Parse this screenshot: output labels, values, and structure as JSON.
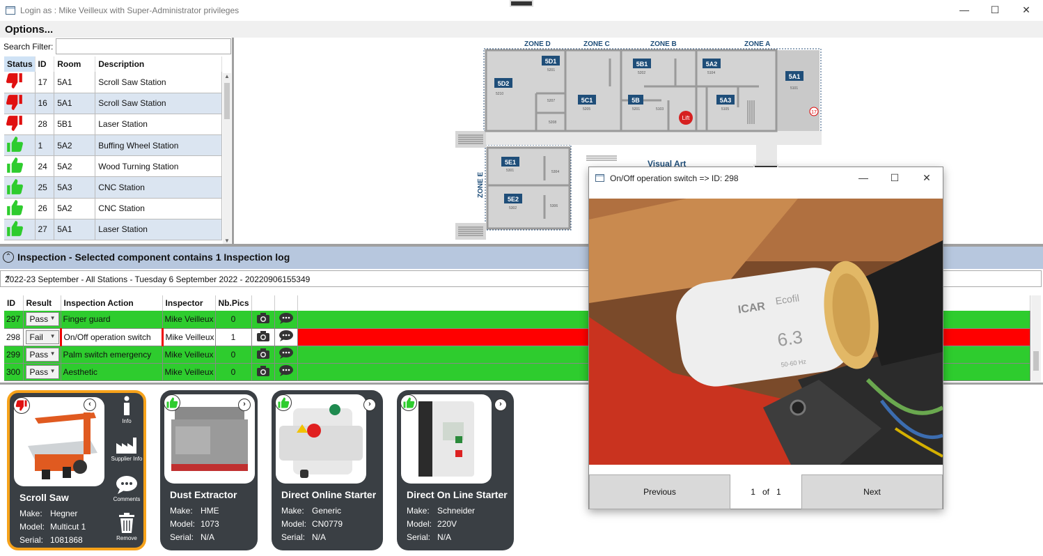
{
  "window": {
    "title": "Login as : Mike Veilleux with Super-Administrator privileges",
    "controls": {
      "minimize": "—",
      "maximize": "☐",
      "close": "✕"
    }
  },
  "menu": {
    "options": "Options..."
  },
  "search": {
    "label": "Search Filter:",
    "value": ""
  },
  "stations": {
    "headers": [
      "Status",
      "ID",
      "Room",
      "Description"
    ],
    "rows": [
      {
        "status": "fail",
        "id": "17",
        "room": "5A1",
        "desc": "Scroll Saw Station"
      },
      {
        "status": "fail",
        "id": "16",
        "room": "5A1",
        "desc": "Scroll Saw Station"
      },
      {
        "status": "fail",
        "id": "28",
        "room": "5B1",
        "desc": "Laser Station"
      },
      {
        "status": "pass",
        "id": "1",
        "room": "5A2",
        "desc": "Buffing Wheel Station"
      },
      {
        "status": "pass",
        "id": "24",
        "room": "5A2",
        "desc": "Wood Turning Station"
      },
      {
        "status": "pass",
        "id": "25",
        "room": "5A3",
        "desc": "CNC Station"
      },
      {
        "status": "pass",
        "id": "26",
        "room": "5A2",
        "desc": "CNC Station"
      },
      {
        "status": "pass",
        "id": "27",
        "room": "5A1",
        "desc": "Laser Station"
      }
    ]
  },
  "floorplan": {
    "zones": [
      "ZONE D",
      "ZONE C",
      "ZONE B",
      "ZONE A",
      "ZONE E"
    ],
    "rooms": [
      {
        "label": "5D1",
        "sub": "5201"
      },
      {
        "label": "5D2",
        "sub": "5210"
      },
      {
        "label": "5C1",
        "sub": "5205"
      },
      {
        "label": "5B1",
        "sub": "5202"
      },
      {
        "label": "5B",
        "sub": "5201"
      },
      {
        "label": "5A2",
        "sub": "5104"
      },
      {
        "label": "5A3",
        "sub": "5105"
      },
      {
        "label": "5A1",
        "sub": "5101"
      },
      {
        "label": "5E1",
        "sub": "5301"
      },
      {
        "label": "5E2",
        "sub": "5302"
      }
    ],
    "small_labels": [
      "5207",
      "5208",
      "5103",
      "5304",
      "5306"
    ],
    "lift": "Lift",
    "marker": "17",
    "visual_art": "Visual Art"
  },
  "inspection": {
    "header": "Inspection - Selected component contains 1 Inspection log",
    "selector": "2022-23 September - All Stations - Tuesday 6 September 2022 - 20220906155349",
    "headers": [
      "ID",
      "Result",
      "Inspection Action",
      "Inspector",
      "Nb.Pics"
    ],
    "rows": [
      {
        "id": "297",
        "result": "Pass",
        "action": "Finger guard",
        "inspector": "Mike Veilleux",
        "pics": "0",
        "state": "pass"
      },
      {
        "id": "298",
        "result": "Fail",
        "action": "On/Off operation switch",
        "inspector": "Mike Veilleux",
        "pics": "1",
        "state": "fail"
      },
      {
        "id": "299",
        "result": "Pass",
        "action": "Palm switch emergency",
        "inspector": "Mike Veilleux",
        "pics": "0",
        "state": "pass"
      },
      {
        "id": "300",
        "result": "Pass",
        "action": "Aesthetic",
        "inspector": "Mike Veilleux",
        "pics": "0",
        "state": "pass"
      }
    ]
  },
  "components": [
    {
      "name": "Scroll Saw",
      "make": "Hegner",
      "model": "Multicut 1",
      "serial": "1081868",
      "status": "fail",
      "selected": true
    },
    {
      "name": "Dust Extractor",
      "make": "HME",
      "model": "1073",
      "serial": "N/A",
      "status": "pass",
      "selected": false
    },
    {
      "name": "Direct Online Starter",
      "make": "Generic",
      "model": "CN0779",
      "serial": "N/A",
      "status": "pass",
      "selected": false
    },
    {
      "name": "Direct On Line Starter",
      "make": "Schneider",
      "model": "220V",
      "serial": "N/A",
      "status": "pass",
      "selected": false
    }
  ],
  "component_fields": {
    "make": "Make:",
    "model": "Model:",
    "serial": "Serial:"
  },
  "side_actions": {
    "info": "Info",
    "supplier": "Supplier Info",
    "comments": "Comments",
    "remove": "Remove"
  },
  "photo_popup": {
    "title": "On/Off operation switch => ID: 298",
    "previous": "Previous",
    "next": "Next",
    "page": "1",
    "of": "of",
    "total": "1",
    "photo_text": {
      "brand": "ICAR",
      "line": "Ecofil",
      "value": "6.3",
      "freq": "50-60 Hz"
    }
  },
  "colors": {
    "pass": "#2ecc2e",
    "fail": "#ff0000",
    "selected": "#f6a21a",
    "header": "#b7c7de",
    "card": "#3a3f44",
    "room": "#1f4e79"
  }
}
